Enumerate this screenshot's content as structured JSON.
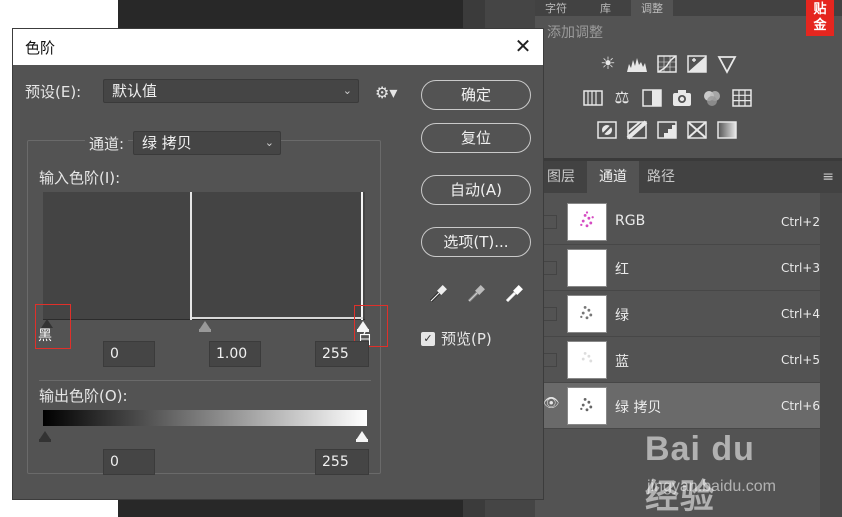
{
  "dialog": {
    "title": "色阶",
    "preset_label": "预设(E):",
    "preset_value": "默认值",
    "channel_label": "通道:",
    "channel_value": "绿 拷贝",
    "input_levels_label": "输入色阶(I):",
    "input_black": "0",
    "input_gamma": "1.00",
    "input_white": "255",
    "output_levels_label": "输出色阶(O):",
    "output_black": "0",
    "output_white": "255",
    "buttons": {
      "ok": "确定",
      "reset": "复位",
      "auto": "自动(A)",
      "options": "选项(T)..."
    },
    "preview_label": "预览(P)",
    "preview_checked": true
  },
  "annotations": {
    "black": "黑",
    "white": "白"
  },
  "adjustments_panel": {
    "tabs": [
      "字符",
      "库",
      "调整"
    ],
    "title": "添加调整"
  },
  "sticker": "贴\n金",
  "channels_panel": {
    "tabs": [
      "图层",
      "通道",
      "路径"
    ],
    "menu_icon": "≡",
    "rows": [
      {
        "name": "RGB",
        "shortcut": "Ctrl+2"
      },
      {
        "name": "红",
        "shortcut": "Ctrl+3"
      },
      {
        "name": "绿",
        "shortcut": "Ctrl+4"
      },
      {
        "name": "蓝",
        "shortcut": "Ctrl+5"
      },
      {
        "name": "绿 拷贝",
        "shortcut": "Ctrl+6"
      }
    ]
  },
  "watermark": {
    "brand": "Bai du 经验",
    "url": "jingyan.baidu.com"
  }
}
